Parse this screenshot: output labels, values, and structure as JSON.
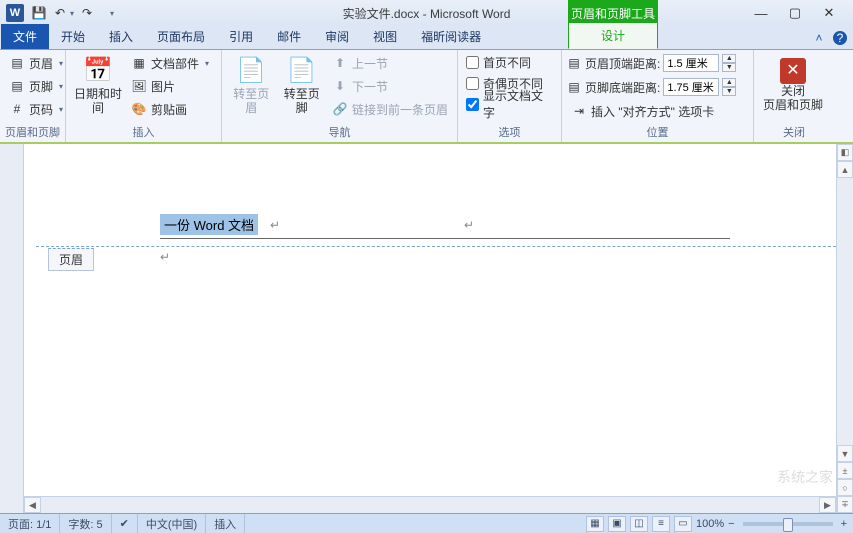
{
  "title": "实验文件.docx - Microsoft Word",
  "contextual_tab_title": "页眉和页脚工具",
  "tabs": {
    "file": "文件",
    "home": "开始",
    "insert": "插入",
    "layout": "页面布局",
    "references": "引用",
    "mailings": "邮件",
    "review": "审阅",
    "view": "视图",
    "foxit": "福昕阅读器",
    "design": "设计"
  },
  "groups": {
    "hf": {
      "label": "页眉和页脚",
      "header": "页眉",
      "footer": "页脚",
      "page_number": "页码"
    },
    "insert": {
      "label": "插入",
      "datetime": "日期和时间",
      "quickparts": "文档部件",
      "picture": "图片",
      "clipart": "剪贴画"
    },
    "nav": {
      "label": "导航",
      "goto_header": "转至页眉",
      "goto_footer": "转至页脚",
      "prev": "上一节",
      "next": "下一节",
      "link": "链接到前一条页眉"
    },
    "options": {
      "label": "选项",
      "diff_first": "首页不同",
      "diff_odd_even": "奇偶页不同",
      "show_doc": "显示文档文字"
    },
    "position": {
      "label": "位置",
      "header_top": "页眉顶端距离:",
      "footer_bottom": "页脚底端距离:",
      "header_val": "1.5 厘米",
      "footer_val": "1.75 厘米",
      "align_tab": "插入 \"对齐方式\" 选项卡"
    },
    "close": {
      "label": "关闭",
      "close_hf": "关闭\n页眉和页脚"
    }
  },
  "document": {
    "header_text": "一份 Word 文档",
    "header_tag": "页眉"
  },
  "statusbar": {
    "page": "页面: 1/1",
    "words": "字数: 5",
    "lang": "中文(中国)",
    "mode": "插入",
    "zoom": "100%"
  },
  "watermark": "系统之家"
}
